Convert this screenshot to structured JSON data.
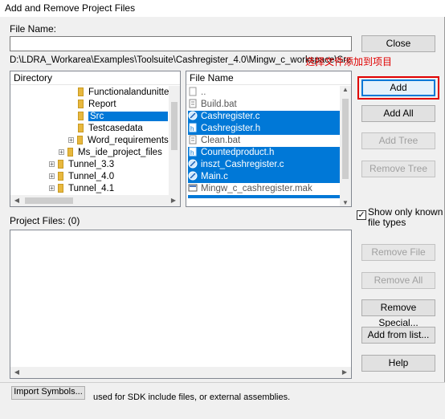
{
  "window": {
    "title": "Add and Remove Project Files"
  },
  "file_name": {
    "label": "File Name:",
    "value": ""
  },
  "path_text": "D:\\LDRA_Workarea\\Examples\\Toolsuite\\Cashregister_4.0\\Mingw_c_workspace\\Src",
  "annotation": "选择文件添加到项目",
  "directory": {
    "header": "Directory",
    "items": [
      {
        "label": "Functionalandunittest"
      },
      {
        "label": "Report"
      },
      {
        "label": "Src"
      },
      {
        "label": "Testcasedata"
      },
      {
        "label": "Word_requirements"
      },
      {
        "label": "Ms_ide_project_files"
      },
      {
        "label": "Tunnel_3.3"
      },
      {
        "label": "Tunnel_4.0"
      },
      {
        "label": "Tunnel_4.1"
      }
    ]
  },
  "files": {
    "header": "File Name",
    "items": [
      {
        "label": "..",
        "selected": false,
        "icon": "parent"
      },
      {
        "label": "Build.bat",
        "selected": false,
        "icon": "bat"
      },
      {
        "label": "Cashregister.c",
        "selected": true,
        "icon": "c"
      },
      {
        "label": "Cashregister.h",
        "selected": true,
        "icon": "h"
      },
      {
        "label": "Clean.bat",
        "selected": false,
        "icon": "bat"
      },
      {
        "label": "Countedproduct.h",
        "selected": true,
        "icon": "h"
      },
      {
        "label": "inszt_Cashregister.c",
        "selected": true,
        "icon": "c"
      },
      {
        "label": "Main.c",
        "selected": true,
        "icon": "c"
      },
      {
        "label": "Mingw_c_cashregister.mak",
        "selected": false,
        "icon": "mak"
      }
    ]
  },
  "buttons": {
    "close": "Close",
    "add": "Add",
    "add_all": "Add All",
    "add_tree": "Add Tree",
    "remove_tree": "Remove Tree",
    "remove_file": "Remove File",
    "remove_all": "Remove All",
    "remove_special": "Remove Special...",
    "add_from_list": "Add from list...",
    "help": "Help"
  },
  "show_only_known": {
    "label_line1": "Show only known",
    "label_line2": "file types",
    "checked": "✓"
  },
  "project_files": {
    "label": "Project Files: (0)"
  },
  "background": {
    "button_label": "Import Symbols...",
    "text": "used for SDK include files, or external assemblies."
  }
}
